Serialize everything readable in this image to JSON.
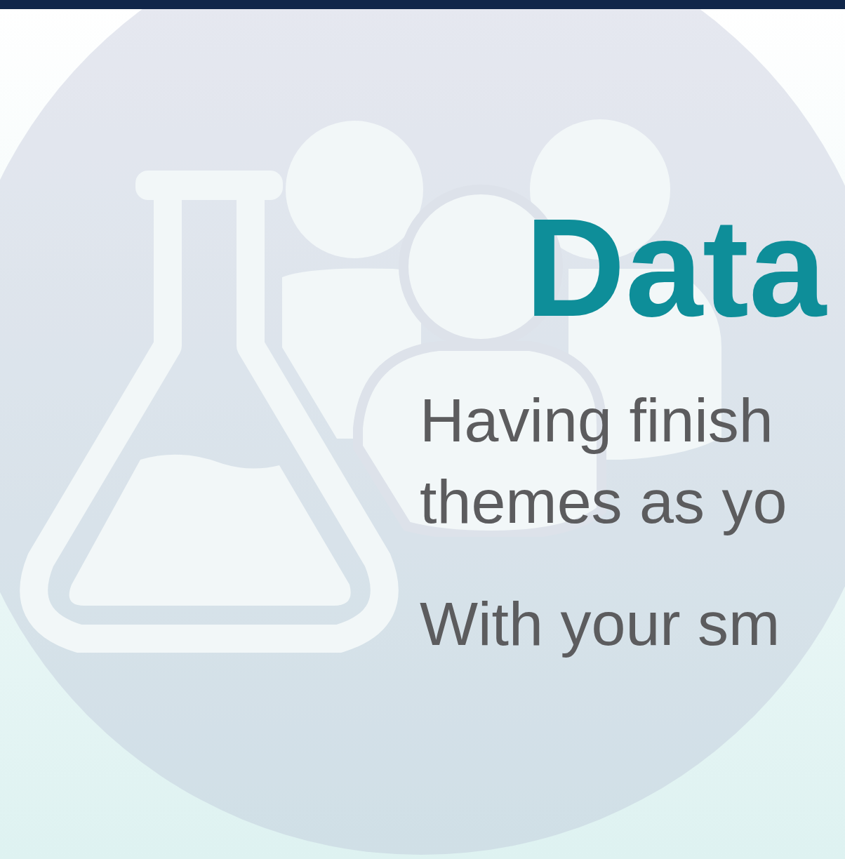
{
  "heading": "Data",
  "paragraphs": [
    {
      "lines": [
        "Having finish",
        "themes as yo"
      ]
    },
    {
      "lines": [
        "With your sm"
      ]
    }
  ]
}
